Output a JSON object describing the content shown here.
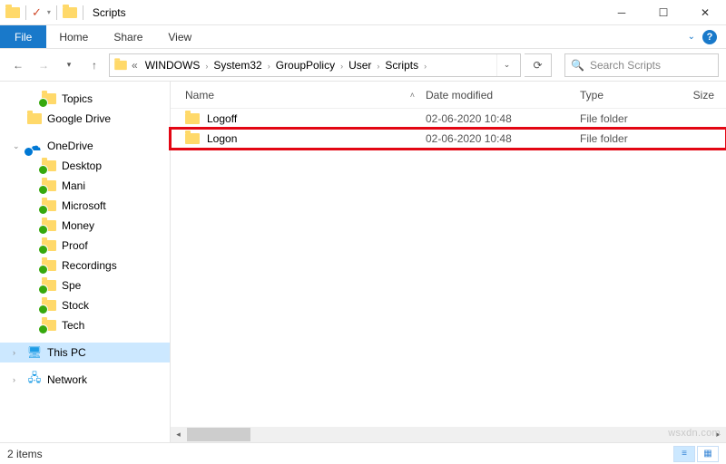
{
  "window": {
    "title": "Scripts"
  },
  "ribbon": {
    "file": "File",
    "tabs": [
      "Home",
      "Share",
      "View"
    ]
  },
  "breadcrumbs": [
    "WINDOWS",
    "System32",
    "GroupPolicy",
    "User",
    "Scripts"
  ],
  "search": {
    "placeholder": "Search Scripts"
  },
  "tree": [
    {
      "label": "Topics",
      "icon": "folder",
      "sync": true,
      "level": 1
    },
    {
      "label": "Google Drive",
      "icon": "folder",
      "level": 0,
      "gapAfter": true
    },
    {
      "label": "OneDrive",
      "icon": "onedrive",
      "sync": "cloud",
      "level": 0,
      "twist": "v"
    },
    {
      "label": "Desktop",
      "icon": "folder",
      "sync": true,
      "level": 1
    },
    {
      "label": "Mani",
      "icon": "folder",
      "sync": true,
      "level": 1
    },
    {
      "label": "Microsoft",
      "icon": "folder",
      "sync": true,
      "level": 1
    },
    {
      "label": "Money",
      "icon": "folder",
      "sync": true,
      "level": 1
    },
    {
      "label": "Proof",
      "icon": "folder",
      "sync": true,
      "level": 1
    },
    {
      "label": "Recordings",
      "icon": "folder",
      "sync": true,
      "level": 1
    },
    {
      "label": "Spe",
      "icon": "folder",
      "sync": true,
      "level": 1
    },
    {
      "label": "Stock",
      "icon": "folder",
      "sync": true,
      "level": 1
    },
    {
      "label": "Tech",
      "icon": "folder",
      "sync": true,
      "level": 1,
      "gapAfter": true
    },
    {
      "label": "This PC",
      "icon": "pc",
      "level": 0,
      "twist": ">",
      "selected": true,
      "gapAfter": true
    },
    {
      "label": "Network",
      "icon": "net",
      "level": 0,
      "twist": ">"
    }
  ],
  "columns": {
    "name": "Name",
    "date": "Date modified",
    "type": "Type",
    "size": "Size"
  },
  "rows": [
    {
      "name": "Logoff",
      "date": "02-06-2020 10:48",
      "type": "File folder",
      "highlight": false
    },
    {
      "name": "Logon",
      "date": "02-06-2020 10:48",
      "type": "File folder",
      "highlight": true
    }
  ],
  "status": {
    "text": "2 items"
  },
  "watermark": "wsxdn.com"
}
